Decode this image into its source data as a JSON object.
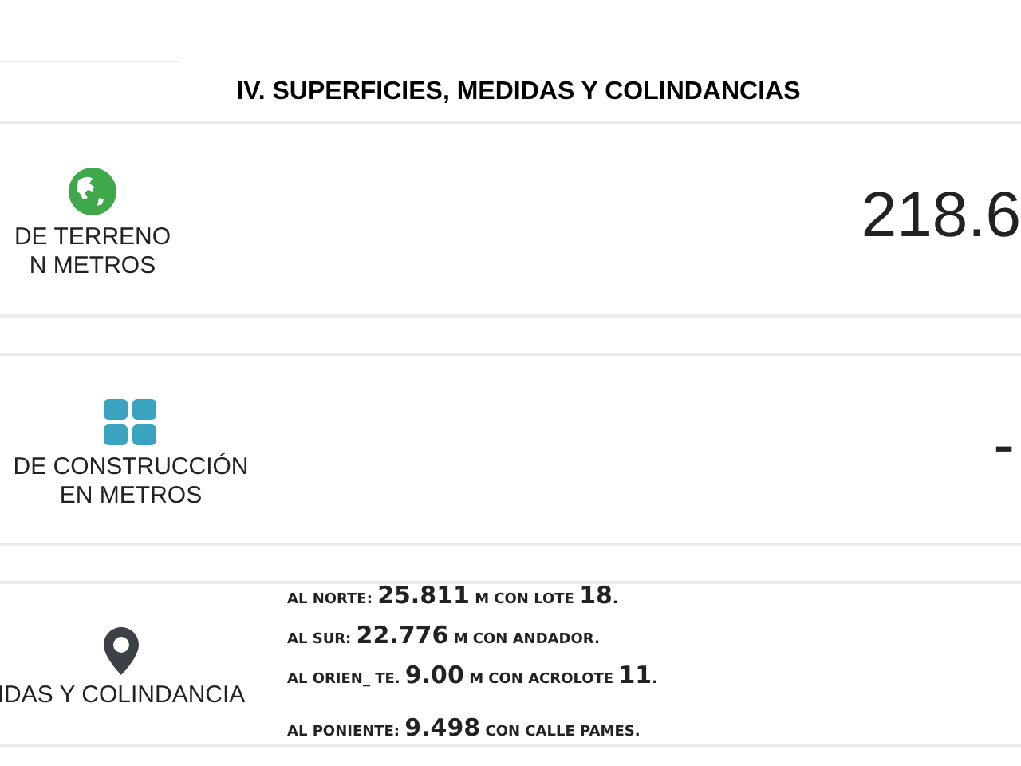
{
  "section_title": "IV. SUPERFICIES, MEDIDAS Y COLINDANCIAS",
  "rows": [
    {
      "kind": "area",
      "label_lines": [
        "DE TERRENO",
        "N METROS"
      ],
      "value": "218.6"
    },
    {
      "kind": "area",
      "label_lines": [
        "DE CONSTRUCCIÓN",
        "EN METROS"
      ],
      "value": "-"
    },
    {
      "kind": "boundaries",
      "label_lines": [
        "IDAS Y COLINDANCIA"
      ],
      "boundaries": [
        [
          {
            "t": "AL NORTE: ",
            "big": false
          },
          {
            "t": "25.811",
            "big": true
          },
          {
            "t": " M CON LOTE ",
            "big": false
          },
          {
            "t": "18",
            "big": true
          },
          {
            "t": ".",
            "big": false
          }
        ],
        [
          {
            "t": "AL SUR: ",
            "big": false
          },
          {
            "t": "22.776",
            "big": true
          },
          {
            "t": " M CON ANDADOR.",
            "big": false
          }
        ],
        [
          {
            "t": "AL ORIEN_ TE. ",
            "big": false
          },
          {
            "t": "9.00",
            "big": true
          },
          {
            "t": " M CON ACROLOTE ",
            "big": false
          },
          {
            "t": "11",
            "big": true
          },
          {
            "t": ".",
            "big": false
          }
        ],
        [
          {
            "t": "AL PONIENTE: ",
            "big": false
          },
          {
            "t": "9.498",
            "big": true
          },
          {
            "t": " CON CALLE PAMES.",
            "big": false
          }
        ]
      ]
    }
  ]
}
